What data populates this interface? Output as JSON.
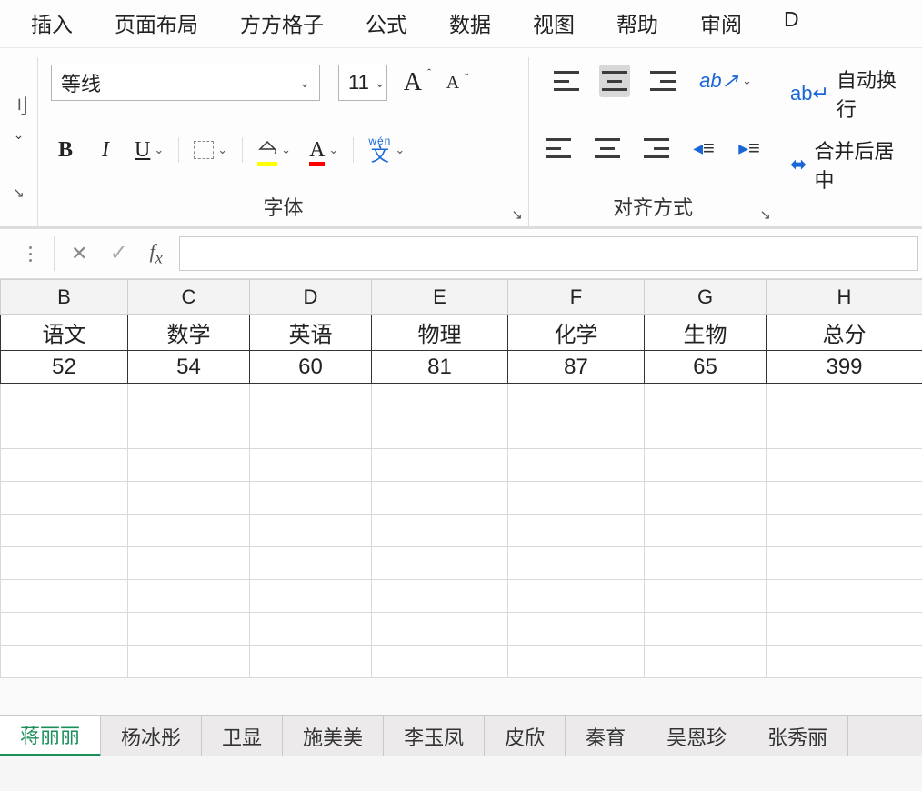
{
  "menu": [
    "插入",
    "页面布局",
    "方方格子",
    "公式",
    "数据",
    "视图",
    "帮助",
    "审阅",
    "D"
  ],
  "ribbon": {
    "font": {
      "name": "等线",
      "size": "11",
      "group_label": "字体"
    },
    "align": {
      "group_label": "对齐方式",
      "wrap_label": "自动换行",
      "merge_label": "合并后居中"
    }
  },
  "columns": [
    "B",
    "C",
    "D",
    "E",
    "F",
    "G",
    "H"
  ],
  "headers": [
    "语文",
    "数学",
    "英语",
    "物理",
    "化学",
    "生物",
    "总分"
  ],
  "values": [
    "52",
    "54",
    "60",
    "81",
    "87",
    "65",
    "399"
  ],
  "sheets": [
    "蒋丽丽",
    "杨冰彤",
    "卫显",
    "施美美",
    "李玉凤",
    "皮欣",
    "秦育",
    "吴恩珍",
    "张秀丽"
  ],
  "active_sheet": 0
}
